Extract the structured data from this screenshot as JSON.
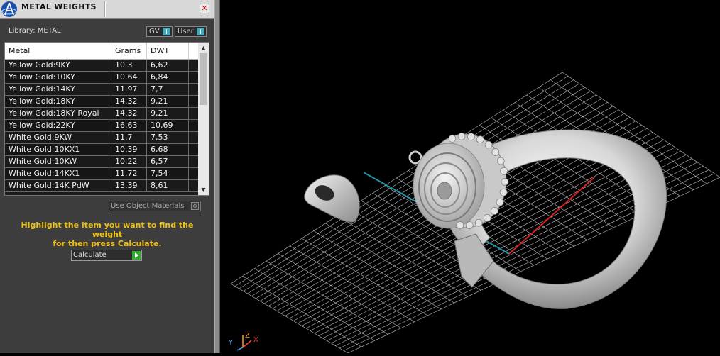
{
  "window": {
    "title": "METAL WEIGHTS",
    "close_glyph": "✕"
  },
  "library": {
    "label": "Library: METAL",
    "toggles": [
      {
        "label": "GV"
      },
      {
        "label": "User"
      }
    ]
  },
  "table": {
    "headers": [
      "Metal",
      "Grams",
      "DWT"
    ],
    "rows": [
      {
        "metal": "Yellow Gold:9KY",
        "grams": "10.3",
        "dwt": "6,62"
      },
      {
        "metal": "Yellow Gold:10KY",
        "grams": "10.64",
        "dwt": "6,84"
      },
      {
        "metal": "Yellow Gold:14KY",
        "grams": "11.97",
        "dwt": "7,7"
      },
      {
        "metal": "Yellow Gold:18KY",
        "grams": "14.32",
        "dwt": "9,21"
      },
      {
        "metal": "Yellow Gold:18KY Royal",
        "grams": "14.32",
        "dwt": "9,21"
      },
      {
        "metal": "Yellow Gold:22KY",
        "grams": "16.63",
        "dwt": "10,69"
      },
      {
        "metal": "White Gold:9KW",
        "grams": "11.7",
        "dwt": "7,53"
      },
      {
        "metal": "White Gold:10KX1",
        "grams": "10.39",
        "dwt": "6,68"
      },
      {
        "metal": "White Gold:10KW",
        "grams": "10.22",
        "dwt": "6,57"
      },
      {
        "metal": "White Gold:14KX1",
        "grams": "11.72",
        "dwt": "7,54"
      },
      {
        "metal": "White Gold:14K PdW",
        "grams": "13.39",
        "dwt": "8,61"
      }
    ]
  },
  "options": {
    "use_object_materials": "Use Object Materials"
  },
  "instructions": {
    "line1": "Highlight the item you want to find the weight",
    "line2": "for then press Calculate."
  },
  "calculate": {
    "label": "Calculate"
  },
  "viewport": {
    "axis_labels": {
      "x": "X",
      "y": "Y",
      "z": "Z"
    },
    "colors": {
      "grid": "#bdbdbd",
      "x_axis": "#d42020",
      "y_axis": "#1f97a8",
      "gizmo_x": "#ff3a3a",
      "gizmo_y": "#4da3ff",
      "gizmo_z": "#ffa020"
    }
  },
  "colors": {
    "panel_bg": "#3d3d3d",
    "accent_toggle": "#49a6b8",
    "instruction_text": "#f0c010",
    "calculate_go": "#35a835"
  }
}
